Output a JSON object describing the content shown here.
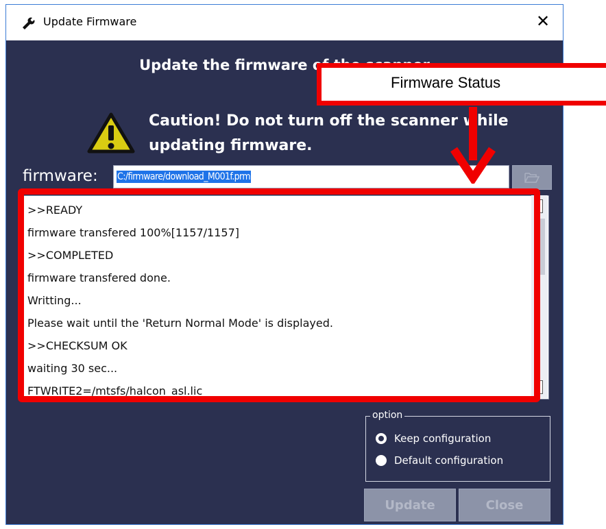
{
  "window": {
    "title": "Update Firmware",
    "close_glyph": "✕",
    "title_icon": "wrench-icon"
  },
  "heading": "Update the firmware of the scanner",
  "caution": {
    "line1": "Caution! Do not turn off the scanner while",
    "line2": "updating firmware.",
    "icon": "warning-icon"
  },
  "firmware": {
    "label": "firmware:",
    "path": "C:/firmware/download_M001f.prm",
    "browse_icon": "folder-open-icon"
  },
  "status_log": [
    ">>READY",
    "firmware transfered 100%[1157/1157]",
    ">>COMPLETED",
    "firmware transfered done.",
    "Writting...",
    "Please wait until the 'Return Normal Mode' is displayed.",
    ">>CHECKSUM OK",
    "waiting 30 sec...",
    "FTWRITE2=/mtsfs/halcon_asl.lic"
  ],
  "option": {
    "legend": "option",
    "choices": [
      {
        "label": "Keep configuration",
        "selected": true
      },
      {
        "label": "Default configuration",
        "selected": false
      }
    ]
  },
  "buttons": {
    "update": "Update",
    "close": "Close"
  },
  "annotation": {
    "label": "Firmware Status",
    "color": "#f00000"
  },
  "colors": {
    "dialog_bg": "#2b3050",
    "selection": "#1e73e8",
    "disabled_button": "#8c93a8"
  }
}
